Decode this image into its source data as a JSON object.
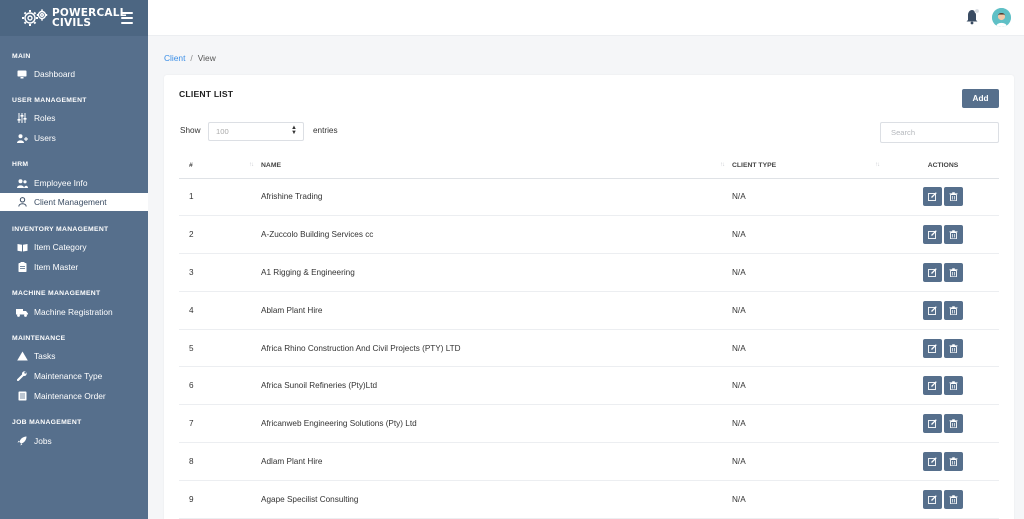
{
  "brand": {
    "line1": "POWERCALL",
    "line2": "CIVILS"
  },
  "sidebar": {
    "sections": [
      {
        "label": "MAIN",
        "items": [
          {
            "label": "Dashboard",
            "icon": "monitor-icon"
          }
        ]
      },
      {
        "label": "USER MANAGEMENT",
        "items": [
          {
            "label": "Roles",
            "icon": "sliders-icon"
          },
          {
            "label": "Users",
            "icon": "user-plus-icon"
          }
        ]
      },
      {
        "label": "HRM",
        "items": [
          {
            "label": "Employee Info",
            "icon": "users-icon"
          },
          {
            "label": "Client Management",
            "icon": "user-icon",
            "active": true
          }
        ]
      },
      {
        "label": "INVENTORY MANAGEMENT",
        "items": [
          {
            "label": "Item Category",
            "icon": "book-icon"
          },
          {
            "label": "Item Master",
            "icon": "clipboard-icon"
          }
        ]
      },
      {
        "label": "MACHINE MANAGEMENT",
        "items": [
          {
            "label": "Machine Registration",
            "icon": "truck-icon"
          }
        ]
      },
      {
        "label": "MAINTENANCE",
        "items": [
          {
            "label": "Tasks",
            "icon": "warning-icon"
          },
          {
            "label": "Maintenance Type",
            "icon": "wrench-icon"
          },
          {
            "label": "Maintenance Order",
            "icon": "list-icon"
          }
        ]
      },
      {
        "label": "JOB MANAGEMENT",
        "items": [
          {
            "label": "Jobs",
            "icon": "rocket-icon"
          }
        ]
      }
    ]
  },
  "breadcrumb": {
    "parent": "Client",
    "separator": "/",
    "current": "View"
  },
  "card": {
    "title": "CLIENT LIST",
    "add_label": "Add",
    "show_label": "Show",
    "entries_value": "100",
    "entries_label": "entries",
    "search_placeholder": "Search"
  },
  "table": {
    "headers": {
      "num": "#",
      "name": "NAME",
      "type": "CLIENT TYPE",
      "actions": "ACTIONS"
    },
    "rows": [
      {
        "num": "1",
        "name": "Afrishine Trading",
        "type": "N/A"
      },
      {
        "num": "2",
        "name": "A-Zuccolo Building Services cc",
        "type": "N/A"
      },
      {
        "num": "3",
        "name": "A1 Rigging & Engineering",
        "type": "N/A"
      },
      {
        "num": "4",
        "name": "Ablam Plant Hire",
        "type": "N/A"
      },
      {
        "num": "5",
        "name": "Africa Rhino Construction And Civil Projects (PTY) LTD",
        "type": "N/A"
      },
      {
        "num": "6",
        "name": "Africa Sunoil Refineries (Pty)Ltd",
        "type": "N/A"
      },
      {
        "num": "7",
        "name": "Africanweb Engineering Solutions (Pty) Ltd",
        "type": "N/A"
      },
      {
        "num": "8",
        "name": "Adlam Plant Hire",
        "type": "N/A"
      },
      {
        "num": "9",
        "name": "Agape Specilist Consulting",
        "type": "N/A"
      }
    ]
  },
  "colors": {
    "sidebar": "#566f8c",
    "accent": "#3a8ee6",
    "button": "#566f8c"
  }
}
